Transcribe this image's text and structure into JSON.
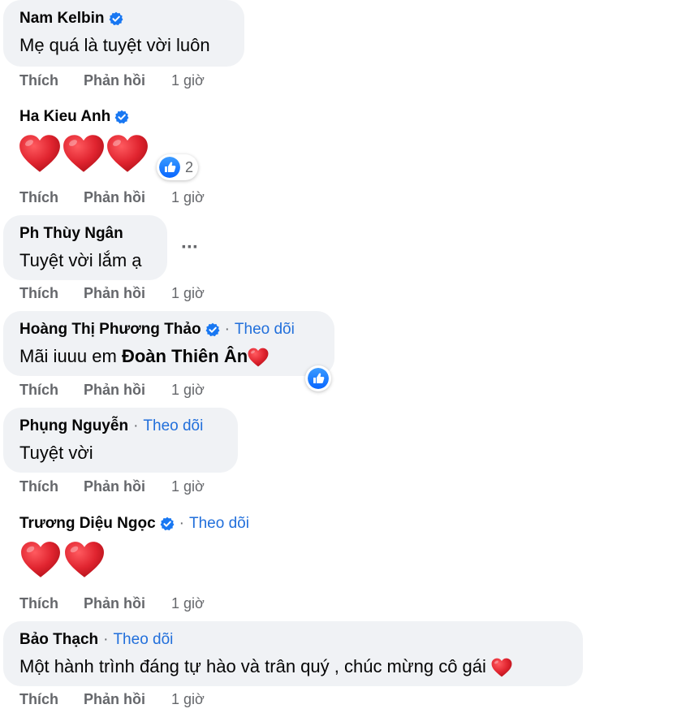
{
  "actions": {
    "like": "Thích",
    "reply": "Phản hồi"
  },
  "comments": [
    {
      "name": "Nam Kelbin",
      "verified": true,
      "follow": "",
      "text": "Mẹ quá là tuyệt vời luôn",
      "time": "1 giờ"
    },
    {
      "name": "Ha Kieu Anh",
      "verified": true,
      "follow": "",
      "emoji": "3 red hearts",
      "reactions": {
        "icon": "like-icon",
        "count": "2"
      },
      "time": "1 giờ"
    },
    {
      "name": "Ph Thùy Ngân",
      "verified": false,
      "follow": "",
      "text": "Tuyệt vời lắm ạ",
      "more": "···",
      "time": "1 giờ"
    },
    {
      "name": "Hoàng Thị Phương Thảo",
      "verified": true,
      "follow": "Theo dõi",
      "text_prefix": "Mãi iuuu em ",
      "mention": "Đoàn Thiên Ân",
      "reactions": {
        "icon": "like-icon",
        "count": ""
      },
      "time": "1 giờ"
    },
    {
      "name": "Phụng Nguyễn",
      "verified": false,
      "follow": "Theo dõi",
      "text": "Tuyệt vời",
      "time": "1 giờ"
    },
    {
      "name": "Trương Diệu Ngọc",
      "verified": true,
      "follow": "Theo dõi",
      "emoji": "2 red hearts",
      "time": "1 giờ"
    },
    {
      "name": "Bảo Thạch",
      "verified": false,
      "follow": "Theo dõi",
      "text": "Một hành trình đáng tự hào và trân quý , chúc mừng cô gái ",
      "time": "1 giờ"
    }
  ],
  "colors": {
    "bubble": "#f0f2f5",
    "link": "#216fdb",
    "muted": "#65676b",
    "heart": "#e0242f",
    "like": "#1877f2"
  },
  "separator": "·"
}
